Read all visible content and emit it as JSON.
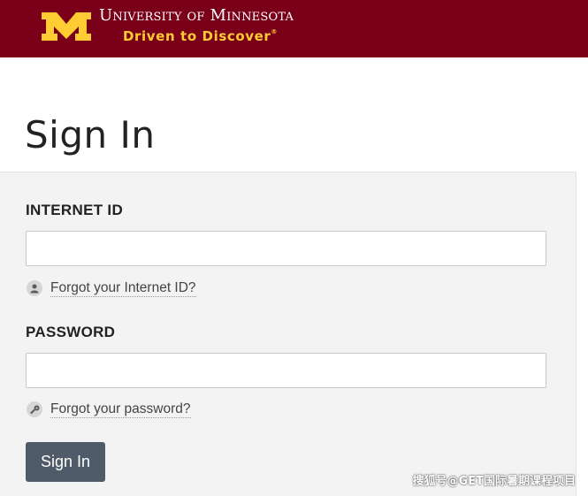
{
  "header": {
    "university_name": "University of Minnesota",
    "tagline": "Driven to Discover",
    "tagline_mark": "®",
    "brand_color": "#7a0019",
    "accent_color": "#ffcc33",
    "logo_icon": "block-m-logo"
  },
  "page": {
    "title": "Sign In"
  },
  "form": {
    "internet_id": {
      "label": "INTERNET ID",
      "value": "",
      "help_icon": "person-icon",
      "help_text": "Forgot your Internet ID?"
    },
    "password": {
      "label": "PASSWORD",
      "value": "",
      "help_icon": "key-icon",
      "help_text": "Forgot your password?"
    },
    "submit_label": "Sign In"
  },
  "watermark": "搜狐号@GET国际暑期课程项目"
}
